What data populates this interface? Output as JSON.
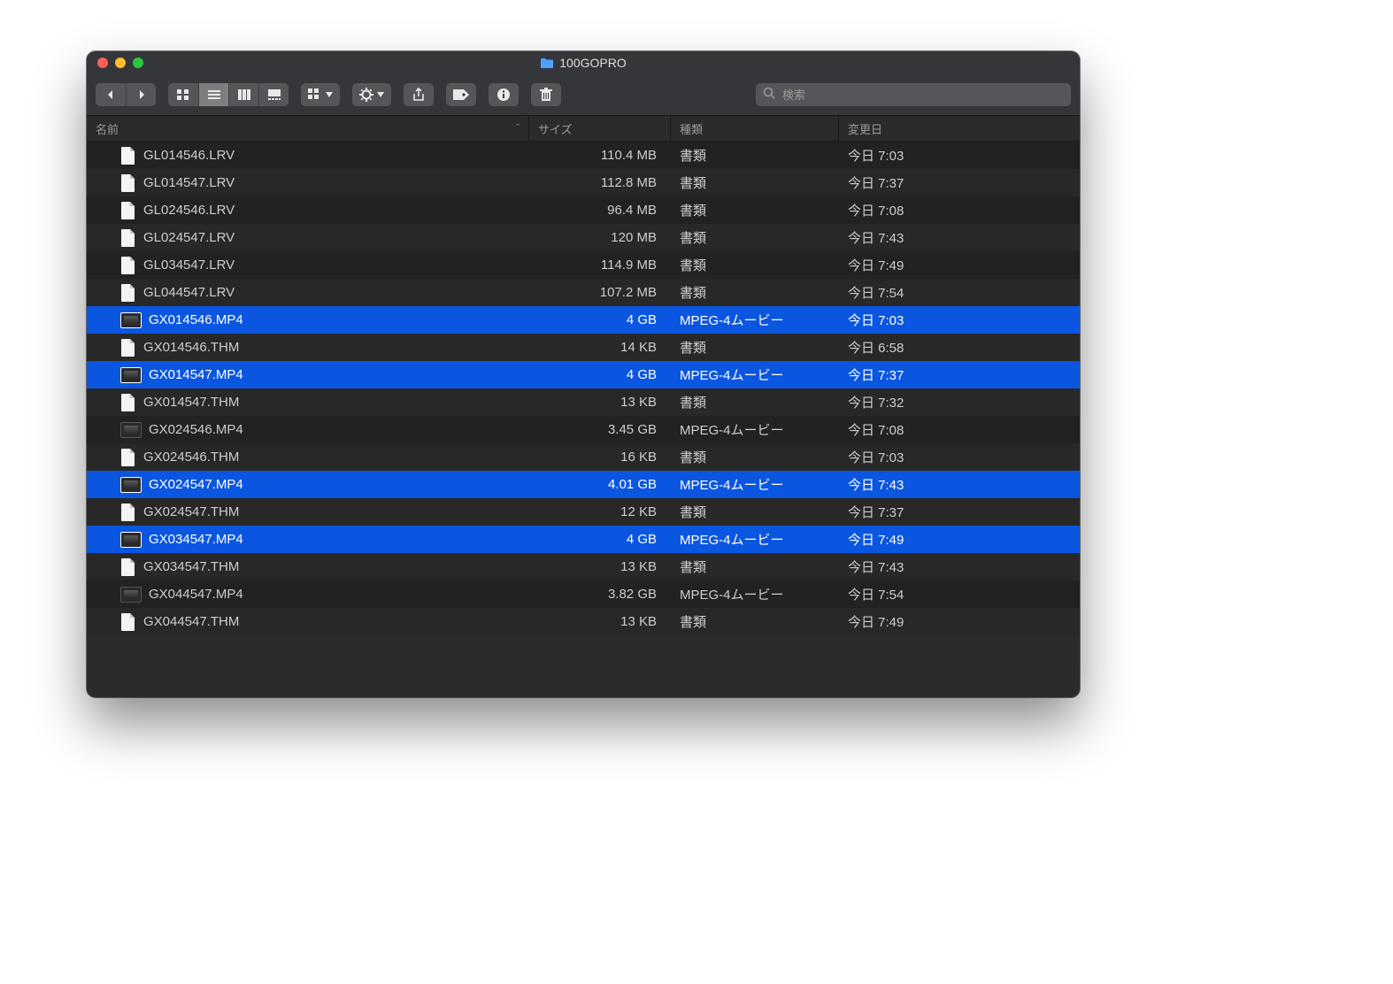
{
  "window": {
    "title": "100GOPRO"
  },
  "search": {
    "placeholder": "検索"
  },
  "columns": {
    "name": "名前",
    "size": "サイズ",
    "kind": "種類",
    "date": "変更日",
    "sort_indicator": "ˆ"
  },
  "kinds": {
    "doc": "書類",
    "video": "MPEG-4ムービー"
  },
  "files": [
    {
      "name": "GL014546.LRV",
      "size": "110.4 MB",
      "kind": "書類",
      "date": "今日 7:03",
      "icon": "doc",
      "selected": false
    },
    {
      "name": "GL014547.LRV",
      "size": "112.8 MB",
      "kind": "書類",
      "date": "今日 7:37",
      "icon": "doc",
      "selected": false
    },
    {
      "name": "GL024546.LRV",
      "size": "96.4 MB",
      "kind": "書類",
      "date": "今日 7:08",
      "icon": "doc",
      "selected": false
    },
    {
      "name": "GL024547.LRV",
      "size": "120 MB",
      "kind": "書類",
      "date": "今日 7:43",
      "icon": "doc",
      "selected": false
    },
    {
      "name": "GL034547.LRV",
      "size": "114.9 MB",
      "kind": "書類",
      "date": "今日 7:49",
      "icon": "doc",
      "selected": false
    },
    {
      "name": "GL044547.LRV",
      "size": "107.2 MB",
      "kind": "書類",
      "date": "今日 7:54",
      "icon": "doc",
      "selected": false
    },
    {
      "name": "GX014546.MP4",
      "size": "4 GB",
      "kind": "MPEG-4ムービー",
      "date": "今日 7:03",
      "icon": "video",
      "selected": true
    },
    {
      "name": "GX014546.THM",
      "size": "14 KB",
      "kind": "書類",
      "date": "今日 6:58",
      "icon": "doc",
      "selected": false
    },
    {
      "name": "GX014547.MP4",
      "size": "4 GB",
      "kind": "MPEG-4ムービー",
      "date": "今日 7:37",
      "icon": "video",
      "selected": true
    },
    {
      "name": "GX014547.THM",
      "size": "13 KB",
      "kind": "書類",
      "date": "今日 7:32",
      "icon": "doc",
      "selected": false
    },
    {
      "name": "GX024546.MP4",
      "size": "3.45 GB",
      "kind": "MPEG-4ムービー",
      "date": "今日 7:08",
      "icon": "video",
      "selected": false
    },
    {
      "name": "GX024546.THM",
      "size": "16 KB",
      "kind": "書類",
      "date": "今日 7:03",
      "icon": "doc",
      "selected": false
    },
    {
      "name": "GX024547.MP4",
      "size": "4.01 GB",
      "kind": "MPEG-4ムービー",
      "date": "今日 7:43",
      "icon": "video",
      "selected": true
    },
    {
      "name": "GX024547.THM",
      "size": "12 KB",
      "kind": "書類",
      "date": "今日 7:37",
      "icon": "doc",
      "selected": false
    },
    {
      "name": "GX034547.MP4",
      "size": "4 GB",
      "kind": "MPEG-4ムービー",
      "date": "今日 7:49",
      "icon": "video",
      "selected": true
    },
    {
      "name": "GX034547.THM",
      "size": "13 KB",
      "kind": "書類",
      "date": "今日 7:43",
      "icon": "doc",
      "selected": false
    },
    {
      "name": "GX044547.MP4",
      "size": "3.82 GB",
      "kind": "MPEG-4ムービー",
      "date": "今日 7:54",
      "icon": "video",
      "selected": false
    },
    {
      "name": "GX044547.THM",
      "size": "13 KB",
      "kind": "書類",
      "date": "今日 7:49",
      "icon": "doc",
      "selected": false
    }
  ]
}
